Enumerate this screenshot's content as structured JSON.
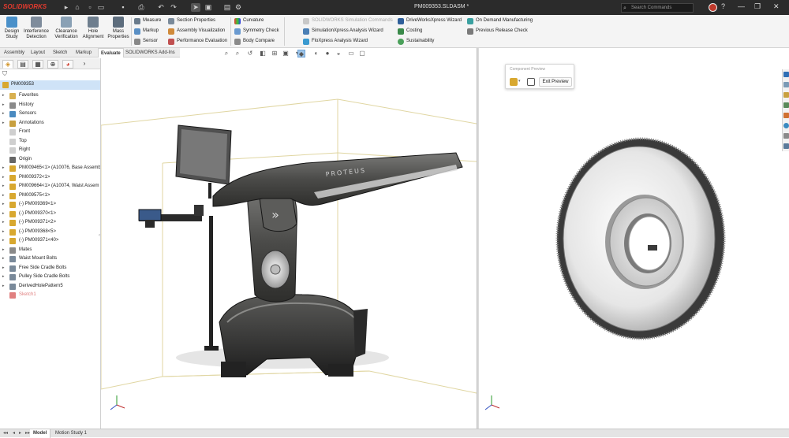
{
  "titlebar": {
    "app_name": "SOLIDWORKS",
    "document_title": "PM009353.SLDASM *",
    "search_placeholder": "Search Commands"
  },
  "ribbon": {
    "big_buttons": [
      "Design\nStudy",
      "Interference\nDetection",
      "Clearance\nVerification",
      "Hole\nAlignment",
      "Mass\nProperties"
    ],
    "col1": [
      "Measure",
      "Markup",
      "Sensor"
    ],
    "col2": [
      "Section Properties",
      "Assembly Visualization",
      "Performance Evaluation"
    ],
    "col3": [
      "Curvature",
      "Symmetry Check",
      "Body Compare"
    ],
    "col4": [
      "SOLIDWORKS Simulation Commands",
      "SimulationXpress Analysis Wizard",
      "FloXpress Analysis Wizard"
    ],
    "col5": [
      "DriveWorksXpress Wizard",
      "Costing",
      "Sustainability"
    ],
    "col6": [
      "On Demand Manufacturing",
      "Previous Release Check"
    ]
  },
  "command_tabs": [
    "Assembly",
    "Layout",
    "Sketch",
    "Markup",
    "Evaluate",
    "SOLIDWORKS Add-Ins"
  ],
  "active_command_tab": "Evaluate",
  "tree": {
    "root": "PM009353",
    "items": [
      "Favorites",
      "History",
      "Sensors",
      "Annotations",
      "Front",
      "Top",
      "Right",
      "Origin",
      "PM009465<1> (A10076, Base Assembl",
      "PM009372<1>",
      "PM009664<1> (A10074, Waist Assem",
      "PM009575<1>",
      "(-) PM009369<1>",
      "(-) PM009370<1>",
      "(-) PM009371<2>",
      "(-) PM009368<5>",
      "(-) PM009371<40>",
      "Mates",
      "Waist Mount Bolts",
      "Free Side Cradle Bolts",
      "Pulley Side Cradle Bolts",
      "DerivedHolePattern5",
      "Sketch1"
    ]
  },
  "component_preview": {
    "title": "Component Preview",
    "exit_label": "Exit Preview"
  },
  "bottom_tabs": [
    "Model",
    "Motion Study 1"
  ],
  "active_bottom_tab": "Model",
  "robot_label": "PROTEUS",
  "colors": {
    "accent_red": "#e23a2e",
    "selection_blue": "#cfe3f7",
    "bounding_box": "#e3d9a6"
  }
}
